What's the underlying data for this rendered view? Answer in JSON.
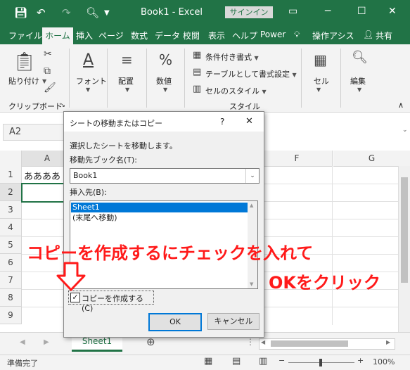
{
  "titlebar": {
    "title": "Book1  -  Excel",
    "signin": "サインイン"
  },
  "ribbon_tabs": [
    "ファイル",
    "ホーム",
    "挿入",
    "ページ",
    "数式",
    "データ",
    "校閲",
    "表示",
    "ヘルプ",
    "Power",
    "操作アシス",
    "共有"
  ],
  "ribbon": {
    "clipboard": {
      "paste": "貼り付け",
      "group": "クリップボード"
    },
    "font": "フォント",
    "alignment": "配置",
    "number": "数値",
    "styles": {
      "conditional": "条件付き書式",
      "table": "テーブルとして書式設定",
      "cell_styles": "セルのスタイル",
      "group": "スタイル"
    },
    "cells": "セル",
    "editing": "編集"
  },
  "formula": {
    "namebox": "A2"
  },
  "grid": {
    "columns": [
      "A",
      "F",
      "G"
    ],
    "rows": [
      "1",
      "2",
      "3",
      "4",
      "5",
      "6",
      "7",
      "8",
      "9"
    ],
    "a1": "ああああ"
  },
  "sheet_tab": "Sheet1",
  "status": {
    "ready": "準備完了",
    "zoom": "100%"
  },
  "dialog": {
    "title": "シートの移動またはコピー",
    "help": "?",
    "close": "✕",
    "message": "選択したシートを移動します。",
    "dest_label": "移動先ブック名(T):",
    "dest_value": "Book1",
    "insert_label": "挿入先(B):",
    "list": [
      "Sheet1",
      "(末尾へ移動)"
    ],
    "copy_label": "コピーを作成する(C)",
    "ok": "OK",
    "cancel": "キャンセル"
  },
  "annotation": {
    "line1": "コピーを作成するにチェックを入れて",
    "line2": "OKをクリック"
  },
  "colors": {
    "excel_green": "#217346",
    "annotation_red": "#ff1a1a",
    "selection_blue": "#0078d7"
  }
}
